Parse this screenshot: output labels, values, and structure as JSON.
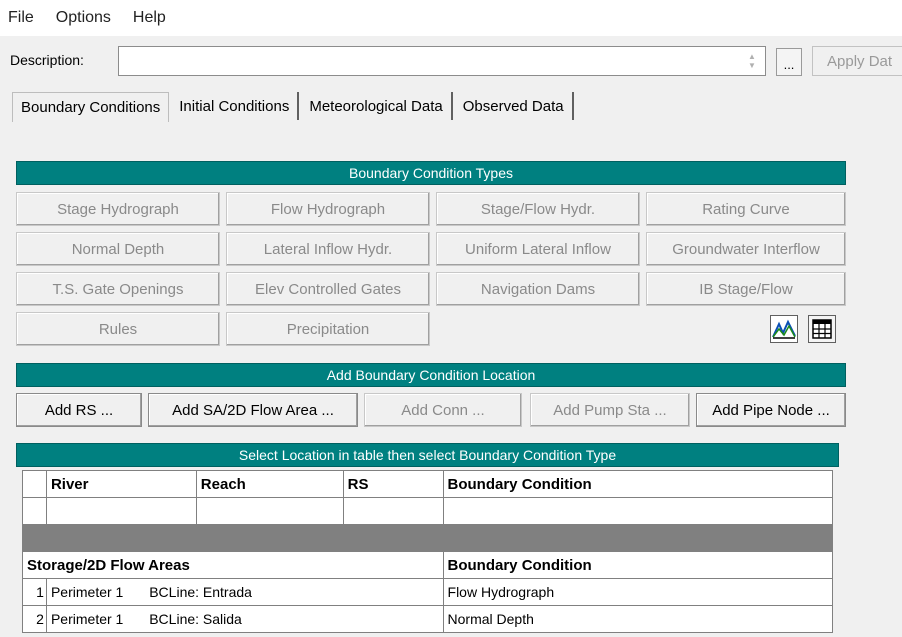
{
  "menu": [
    "File",
    "Options",
    "Help"
  ],
  "description": {
    "label": "Description:",
    "value": "",
    "more_label": "...",
    "apply_label": "Apply Dat"
  },
  "tabs": [
    "Boundary Conditions",
    "Initial Conditions",
    "Meteorological Data",
    "Observed Data"
  ],
  "bc_types": {
    "header": "Boundary Condition Types",
    "buttons": [
      "Stage Hydrograph",
      "Flow Hydrograph",
      "Stage/Flow Hydr.",
      "Rating Curve",
      "Normal Depth",
      "Lateral Inflow Hydr.",
      "Uniform Lateral Inflow",
      "Groundwater Interflow",
      "T.S. Gate Openings",
      "Elev Controlled Gates",
      "Navigation Dams",
      "IB Stage/Flow",
      "Rules",
      "Precipitation"
    ]
  },
  "add_location": {
    "header": "Add Boundary Condition Location",
    "buttons": [
      "Add RS ...",
      "Add SA/2D Flow Area ...",
      "Add Conn ...",
      "Add Pump Sta ...",
      "Add Pipe Node ..."
    ]
  },
  "table": {
    "header": "Select Location in table then select Boundary Condition Type",
    "river_columns": [
      "River",
      "Reach",
      "RS",
      "Boundary Condition"
    ],
    "storage_columns": [
      "Storage/2D Flow Areas",
      "Boundary Condition"
    ],
    "storage_rows": [
      {
        "num": "1",
        "area": "Perimeter 1",
        "bcline": "BCLine: Entrada",
        "condition": "Flow Hydrograph"
      },
      {
        "num": "2",
        "area": "Perimeter 1",
        "bcline": "BCLine: Salida",
        "condition": "Normal Depth"
      }
    ]
  },
  "colors": {
    "teal": "#008080",
    "gray_band": "#808080",
    "disabled_text": "#8a8a8a"
  }
}
